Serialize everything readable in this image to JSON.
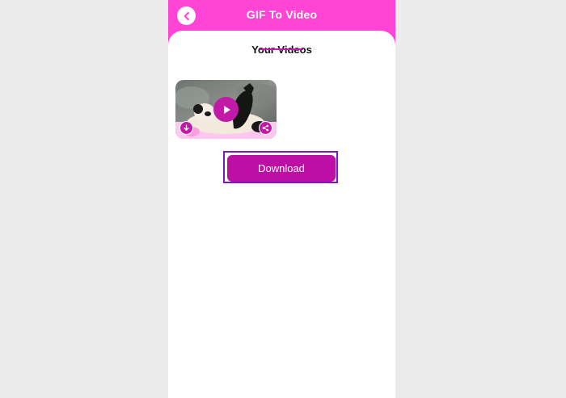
{
  "header": {
    "title": "GIF To Video",
    "back_icon": "chevron-left-icon"
  },
  "tabs": [
    {
      "label": "Your Videos",
      "active": true
    }
  ],
  "videos": [
    {
      "thumbnail": "panda-video-thumbnail",
      "play_icon": "play-icon",
      "download_icon": "arrow-down-icon",
      "share_icon": "share-icon"
    }
  ],
  "download_button": {
    "label": "Download"
  },
  "colors": {
    "header_bg": "#ff44d6",
    "accent": "#c11aa7",
    "button": "#bd0fa4",
    "focus_ring": "#7a16c8",
    "page_bg": "#ebebeb"
  }
}
